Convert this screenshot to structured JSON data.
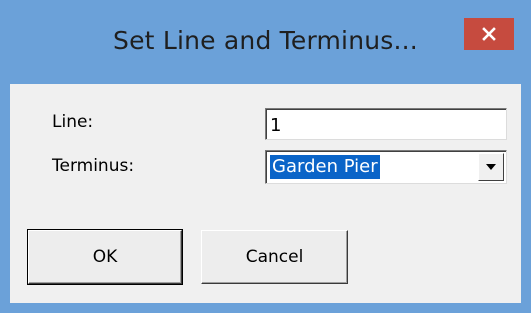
{
  "window": {
    "title": "Set Line and Terminus..."
  },
  "form": {
    "line_label": "Line:",
    "line_value": "1",
    "terminus_label": "Terminus:",
    "terminus_value": "Garden Pier"
  },
  "buttons": {
    "ok_label": "OK",
    "cancel_label": "Cancel"
  },
  "icons": {
    "close": "close-icon",
    "dropdown": "chevron-down-icon"
  },
  "colors": {
    "titlebar": "#6ba1d9",
    "close_button": "#c64b3f",
    "selection": "#0a64c8"
  }
}
